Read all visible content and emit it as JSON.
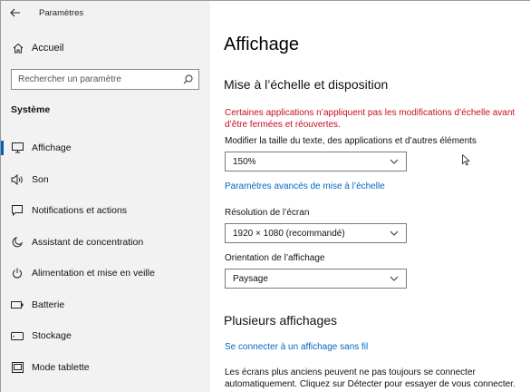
{
  "window": {
    "title": "Paramètres"
  },
  "sidebar": {
    "home_label": "Accueil",
    "search_placeholder": "Rechercher un paramètre",
    "section_title": "Système",
    "items": [
      {
        "label": "Affichage",
        "icon": "monitor-icon",
        "selected": true
      },
      {
        "label": "Son",
        "icon": "speaker-icon"
      },
      {
        "label": "Notifications et actions",
        "icon": "notification-icon"
      },
      {
        "label": "Assistant de concentration",
        "icon": "moon-icon"
      },
      {
        "label": "Alimentation et mise en veille",
        "icon": "power-icon"
      },
      {
        "label": "Batterie",
        "icon": "battery-icon"
      },
      {
        "label": "Stockage",
        "icon": "storage-icon"
      },
      {
        "label": "Mode tablette",
        "icon": "tablet-icon"
      }
    ]
  },
  "main": {
    "title": "Affichage",
    "scale_section": {
      "heading": "Mise à l’échelle et disposition",
      "warning": "Certaines applications n’appliquent pas les modifications d’échelle avant d’être fermées et réouvertes.",
      "text_size_label": "Modifier la taille du texte, des applications et d’autres éléments",
      "text_size_value": "150%",
      "advanced_link": "Paramètres avancés de mise à l’échelle",
      "resolution_label": "Résolution de l’écran",
      "resolution_value": "1920 × 1080 (recommandé)",
      "orientation_label": "Orientation de l’affichage",
      "orientation_value": "Paysage"
    },
    "multi_section": {
      "heading": "Plusieurs affichages",
      "connect_link": "Se connecter à un affichage sans fil",
      "description": "Les écrans plus anciens peuvent ne pas toujours se connecter automatiquement. Cliquez sur Détecter pour essayer de vous connecter."
    }
  },
  "colors": {
    "accent": "#0067c0",
    "warning": "#c50f1f",
    "sidebar_bg": "#f2f2f2"
  }
}
